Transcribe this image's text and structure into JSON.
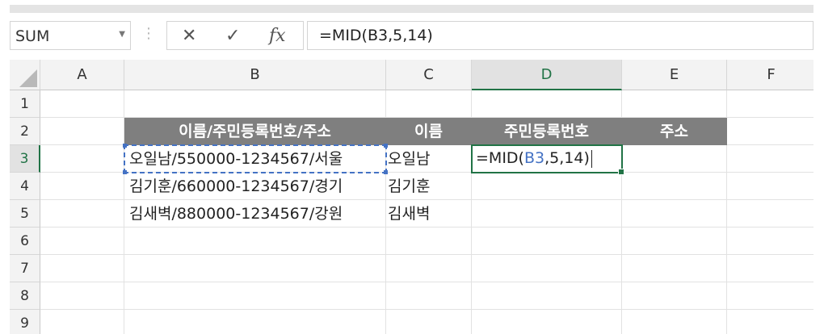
{
  "name_box": {
    "value": "SUM"
  },
  "formula_bar": {
    "cancel_icon": "✕",
    "enter_icon": "✓",
    "fx_label": "fx",
    "formula": "=MID(B3,5,14)"
  },
  "columns": [
    "A",
    "B",
    "C",
    "D",
    "E",
    "F"
  ],
  "rows": [
    "1",
    "2",
    "3",
    "4",
    "5",
    "6",
    "7",
    "8",
    "9"
  ],
  "selected": {
    "column": "D",
    "row": "3"
  },
  "header_row": {
    "b": "이름/주민등록번호/주소",
    "c": "이름",
    "d": "주민등록번호",
    "e": "주소"
  },
  "data_rows": [
    {
      "b": "오일남/550000-1234567/서울",
      "c": "오일남"
    },
    {
      "b": "김기훈/660000-1234567/경기",
      "c": "김기훈"
    },
    {
      "b": "김새벽/880000-1234567/강원",
      "c": "김새벽"
    }
  ],
  "editing_cell": {
    "prefix": "=MID(",
    "ref": "B3",
    "suffix": ",5,14)"
  },
  "colors": {
    "header_fill": "#7f7f7f",
    "selection_green": "#217346",
    "reference_blue": "#4472c4"
  }
}
